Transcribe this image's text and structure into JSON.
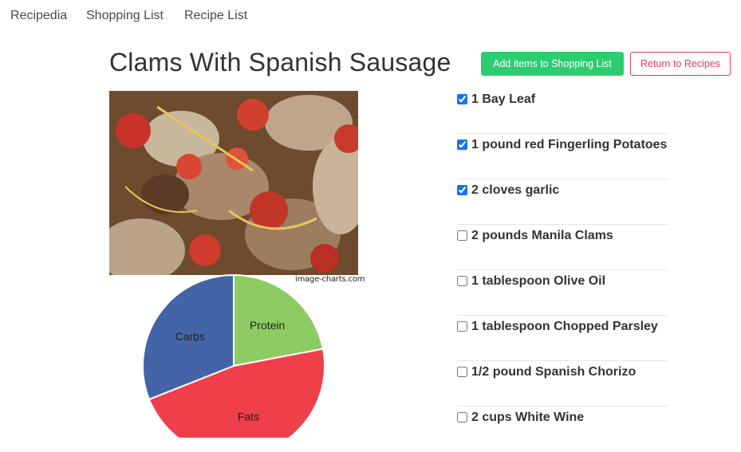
{
  "nav": {
    "brand": "Recipedia",
    "links": [
      "Shopping List",
      "Recipe List"
    ]
  },
  "recipe": {
    "title": "Clams With Spanish Sausage",
    "add_button": "Add items to Shopping List",
    "return_button": "Return to Recipes",
    "image_alt": "Clams with Spanish sausage dish photo"
  },
  "chart": {
    "watermark": "image-charts.com"
  },
  "chart_data": {
    "type": "pie",
    "categories": [
      "Protein",
      "Fats",
      "Carbs"
    ],
    "values": [
      22,
      47,
      31
    ],
    "colors": [
      "#8dcb63",
      "#ef3f4a",
      "#4365a8"
    ]
  },
  "ingredients": [
    {
      "text": "1 Bay Leaf",
      "checked": true
    },
    {
      "text": "1 pound red Fingerling Potatoes",
      "checked": true
    },
    {
      "text": "2 cloves garlic",
      "checked": true
    },
    {
      "text": "2 pounds Manila Clams",
      "checked": false
    },
    {
      "text": "1 tablespoon Olive Oil",
      "checked": false
    },
    {
      "text": "1 tablespoon Chopped Parsley",
      "checked": false
    },
    {
      "text": "1/2 pound Spanish Chorizo",
      "checked": false
    },
    {
      "text": "2 cups White Wine",
      "checked": false
    }
  ]
}
